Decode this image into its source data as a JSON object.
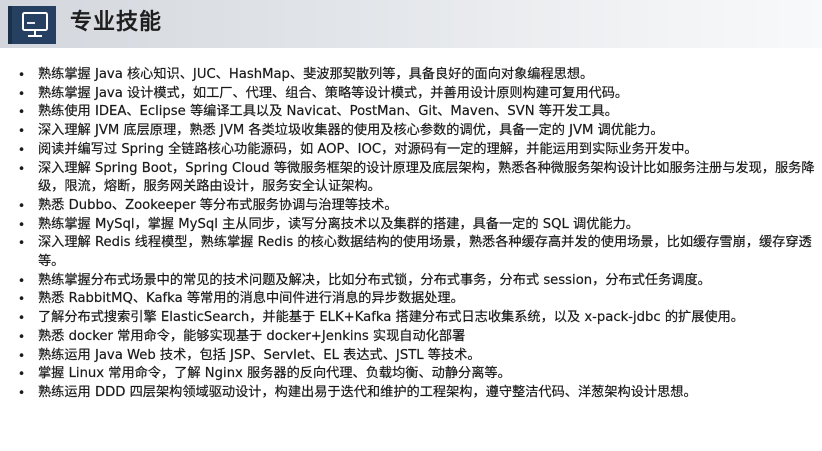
{
  "header": {
    "title": "专业技能",
    "icon": "monitor-icon"
  },
  "skills": [
    "熟练掌握 Java 核心知识、JUC、HashMap、斐波那契散列等，具备良好的面向对象编程思想。",
    "熟练掌握 Java 设计模式，如工厂、代理、组合、策略等设计模式，并善用设计原则构建可复用代码。",
    "熟练使用 IDEA、Eclipse 等编译工具以及 Navicat、PostMan、Git、Maven、SVN 等开发工具。",
    "深入理解 JVM 底层原理，熟悉 JVM 各类垃圾收集器的使用及核心参数的调优，具备一定的 JVM 调优能力。",
    "阅读并编写过 Spring 全链路核心功能源码，如 AOP、IOC，对源码有一定的理解，并能运用到实际业务开发中。",
    "深入理解 Spring Boot，Spring Cloud 等微服务框架的设计原理及底层架构，熟悉各种微服务架构设计比如服务注册与发现，服务降级，限流，熔断，服务网关路由设计，服务安全认证架构。",
    "熟悉 Dubbo、Zookeeper 等分布式服务协调与治理等技术。",
    "熟练掌握 MySql，掌握 MySql 主从同步，读写分离技术以及集群的搭建，具备一定的 SQL 调优能力。",
    "深入理解 Redis 线程模型，熟练掌握 Redis 的核心数据结构的使用场景，熟悉各种缓存高并发的使用场景，比如缓存雪崩，缓存穿透等。",
    "熟练掌握分布式场景中的常见的技术问题及解决，比如分布式锁，分布式事务，分布式 session，分布式任务调度。",
    "熟悉 RabbitMQ、Kafka 等常用的消息中间件进行消息的异步数据处理。",
    "了解分布式搜索引擎 ElasticSearch，并能基于 ELK+Kafka 搭建分布式日志收集系统，以及 x-pack-jdbc 的扩展使用。",
    "熟悉 docker 常用命令，能够实现基于 docker+Jenkins 实现自动化部署",
    "熟练运用 Java Web 技术，包括 JSP、Servlet、EL 表达式、JSTL 等技术。",
    "掌握 Linux 常用命令，了解 Nginx 服务器的反向代理、负载均衡、动静分离等。",
    "熟练运用 DDD 四层架构领域驱动设计，构建出易于迭代和维护的工程架构，遵守整洁代码、洋葱架构设计思想。"
  ]
}
